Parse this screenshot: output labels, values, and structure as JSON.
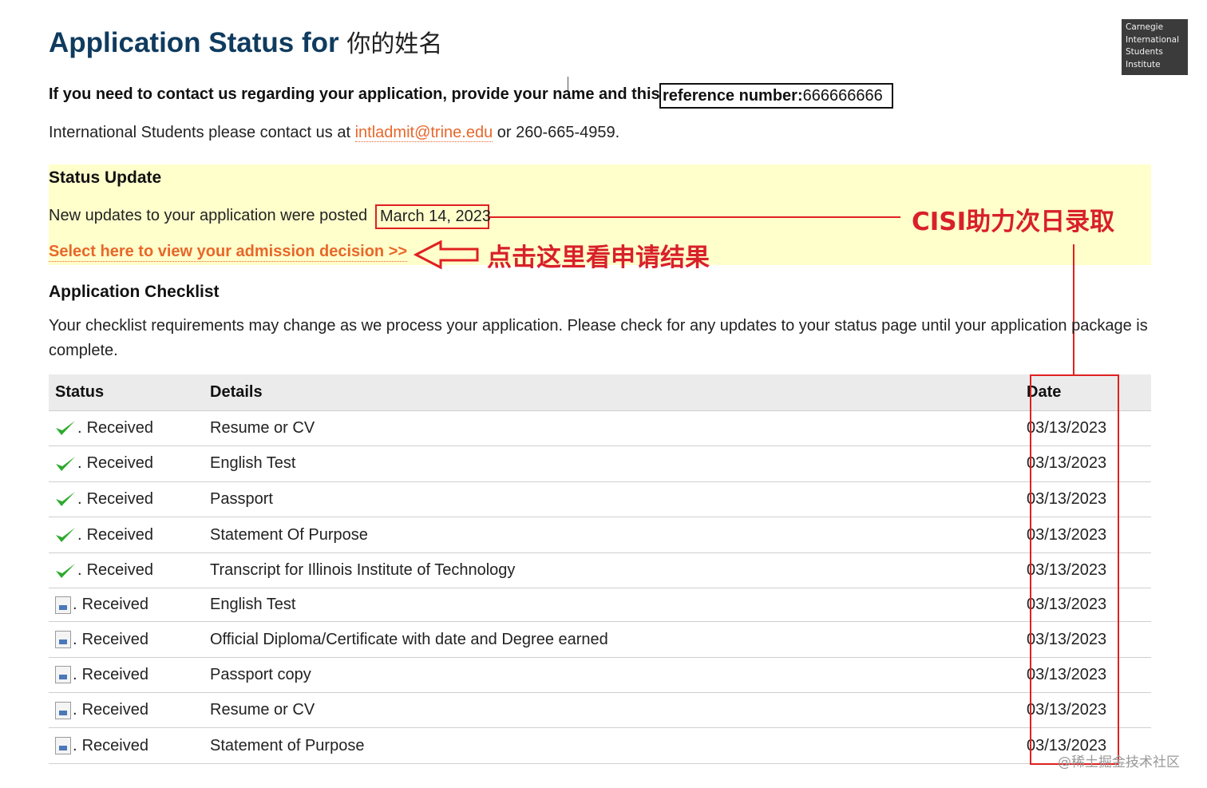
{
  "page": {
    "title": "Application Status for",
    "applicant_name": "你的姓名"
  },
  "logo": {
    "lines": [
      "Carnegie",
      "International",
      "Students",
      "Institute"
    ]
  },
  "contact": {
    "text": "If you need to contact us regarding your application, provide your name and this",
    "reference_label": "reference number:",
    "reference_number": "666666666"
  },
  "international": {
    "prefix": "International Students please contact us at",
    "email": "intladmit@trine.edu",
    "suffix": "or 260-665-4959."
  },
  "status_update": {
    "heading": "Status Update",
    "updates_text": "New updates to your application were posted",
    "posted_date": "March 14, 2023",
    "decision_link": "Select here to view your admission decision >>"
  },
  "annotations": {
    "cisi": "CISI助力次日录取",
    "click_here": "点击这里看申请结果",
    "color": "#e02020"
  },
  "checklist": {
    "heading": "Application Checklist",
    "note": "Your checklist requirements may change as we process your application. Please check for any updates to your status page until your application package is complete.",
    "columns": {
      "status": "Status",
      "details": "Details",
      "date": "Date"
    },
    "rows": [
      {
        "icon": "green-check-icon",
        "status": "Received",
        "details": "Resume or CV",
        "date": "03/13/2023"
      },
      {
        "icon": "green-check-icon",
        "status": "Received",
        "details": "English Test",
        "date": "03/13/2023"
      },
      {
        "icon": "green-check-icon",
        "status": "Received",
        "details": "Passport",
        "date": "03/13/2023"
      },
      {
        "icon": "green-check-icon",
        "status": "Received",
        "details": "Statement Of Purpose",
        "date": "03/13/2023"
      },
      {
        "icon": "green-check-icon",
        "status": "Received",
        "details": "Transcript for Illinois Institute of Technology",
        "date": "03/13/2023"
      },
      {
        "icon": "document-icon",
        "status": "Received",
        "details": "English Test",
        "date": "03/13/2023"
      },
      {
        "icon": "document-icon",
        "status": "Received",
        "details": "Official Diploma/Certificate with date and Degree earned",
        "date": "03/13/2023"
      },
      {
        "icon": "document-icon",
        "status": "Received",
        "details": "Passport copy",
        "date": "03/13/2023"
      },
      {
        "icon": "document-icon",
        "status": "Received",
        "details": "Resume or CV",
        "date": "03/13/2023"
      },
      {
        "icon": "document-icon",
        "status": "Received",
        "details": "Statement of Purpose",
        "date": "03/13/2023"
      }
    ],
    "status_separator": "."
  },
  "watermark": "@稀土掘金技术社区",
  "colors": {
    "title": "#0f3b5f",
    "link": "#e8672a",
    "status_panel": "#ffffcc",
    "annotation_red": "#d8202a",
    "check_green": "#2eaa2e"
  }
}
